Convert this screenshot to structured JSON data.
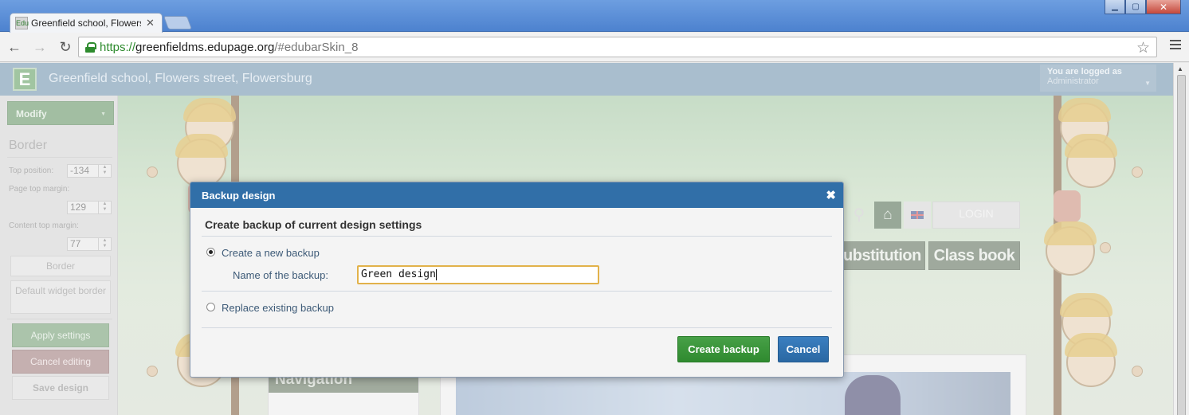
{
  "browser": {
    "tab_title": "Greenfield school, Flowers st",
    "tab_favicon_text": "Edu",
    "url_scheme": "https://",
    "url_host": "greenfieldms.edupage.org",
    "url_path": "/#edubarSkin_8"
  },
  "site": {
    "school_name": "Greenfield school, Flowers street, Flowersburg",
    "logged_title": "You are logged as",
    "logged_user": "Administrator",
    "login_label": "LOGIN",
    "menu_items": [
      "Substitution",
      "Class book"
    ],
    "navigation_title": "Navigation"
  },
  "sidebar": {
    "modify_label": "Modify",
    "section_title": "Border",
    "top_position_label": "Top position:",
    "top_position_value": "-134",
    "page_top_margin_label": "Page top margin:",
    "page_top_margin_value": "129",
    "content_top_margin_label": "Content top margin:",
    "content_top_margin_value": "77",
    "border_button": "Border",
    "default_widget_border_button": "Default widget border",
    "apply_settings": "Apply settings",
    "cancel_editing": "Cancel editing",
    "save_design": "Save design"
  },
  "dialog": {
    "title": "Backup design",
    "heading": "Create backup of current design settings",
    "option_new": "Create a new backup",
    "option_new_selected": true,
    "name_label": "Name of the backup:",
    "name_value": "Green design",
    "option_replace": "Replace existing backup",
    "create_button": "Create backup",
    "cancel_button": "Cancel"
  },
  "colors": {
    "dialog_header": "#316fa8",
    "create_button": "#3a943a",
    "cancel_button": "#2f73b3",
    "input_focus_border": "#e2b24a"
  }
}
